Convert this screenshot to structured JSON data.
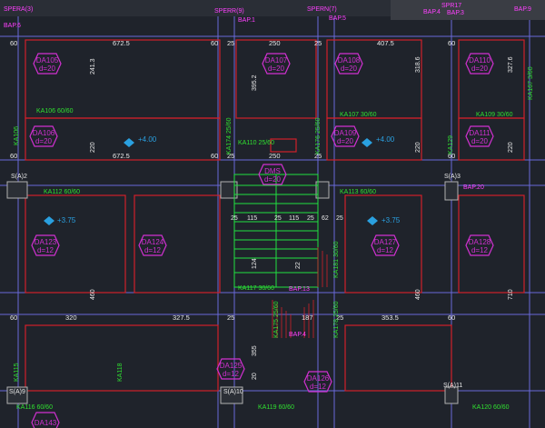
{
  "window": {
    "title": "CAD floor plan - slab and beam layout"
  },
  "colors": {
    "background": "#1f232b",
    "slab_outline": "#d0202a",
    "slab_label": "#d030d0",
    "grid": "#6a6ad8",
    "dimension": "#e8e8e8",
    "beam_label": "#30e030",
    "level_marker": "#2aa0e0",
    "column": "#b0b0b0",
    "stair": "#20e040",
    "beam_tag": "#ff40ff"
  },
  "top_tags": [
    "SPERA(3)",
    "SPERR(9)",
    "SPERN(7)",
    "SPR17",
    "BAP.6",
    "BAP.1",
    "BAP.5",
    "BAP.4",
    "BAP.3",
    "BAP.9"
  ],
  "dimensions_top": [
    "60",
    "672.5",
    "60",
    "25",
    "250",
    "25",
    "407.5",
    "60"
  ],
  "dimensions_mid": [
    "60",
    "672.5",
    "60",
    "25",
    "250",
    "25",
    "60"
  ],
  "dimensions_low": [
    "60",
    "320",
    "327.5",
    "25",
    "187",
    "25",
    "353.5",
    "60"
  ],
  "dimensions_vertical": [
    "241.3",
    "395.2",
    "318.6",
    "327.6",
    "220",
    "220",
    "220",
    "460",
    "460",
    "710",
    "355",
    "20",
    "124",
    "22"
  ],
  "slabs": [
    {
      "name": "DA105",
      "thickness": "d=20"
    },
    {
      "name": "DA107",
      "thickness": "d=20"
    },
    {
      "name": "DA108",
      "thickness": "d=20"
    },
    {
      "name": "DA110",
      "thickness": "d=20"
    },
    {
      "name": "DA106",
      "thickness": "d=20"
    },
    {
      "name": "DA109",
      "thickness": "d=20"
    },
    {
      "name": "DA111",
      "thickness": "d=20"
    },
    {
      "name": "DMS",
      "thickness": "d=20"
    },
    {
      "name": "DA123",
      "thickness": "d=12"
    },
    {
      "name": "DA124",
      "thickness": "d=12"
    },
    {
      "name": "DA127",
      "thickness": "d=12"
    },
    {
      "name": "DA128",
      "thickness": "d=12"
    },
    {
      "name": "DA125",
      "thickness": "d=12"
    },
    {
      "name": "DA126",
      "thickness": "d=12"
    },
    {
      "name": "DA143",
      "thickness": ""
    }
  ],
  "beams": [
    "KA106 60/60",
    "KA107 30/60",
    "KA109 30/60",
    "KA110 25/60",
    "KA112 60/60",
    "KA113 60/60",
    "KA117 30/60",
    "KA116 60/60",
    "KA119 60/60",
    "KA120 60/60",
    "KA106",
    "KA167 3/60",
    "KA174 25/60",
    "KA176 25/60",
    "KA175 25/60",
    "KA178 25/60",
    "KA181 30/60",
    "KA115",
    "KA118",
    "KA129"
  ],
  "beam_tags": [
    "BAP.20",
    "BAP.13",
    "BAP.4"
  ],
  "columns": [
    "S(A)2",
    "S(A)3",
    "S(A)9",
    "S(A)10",
    "S(A)11"
  ],
  "levels": [
    "+4.00",
    "+4.00",
    "+3.75",
    "+3.75"
  ],
  "stair": {
    "dims": [
      "25",
      "115",
      "25",
      "115",
      "25",
      "62",
      "25"
    ]
  }
}
